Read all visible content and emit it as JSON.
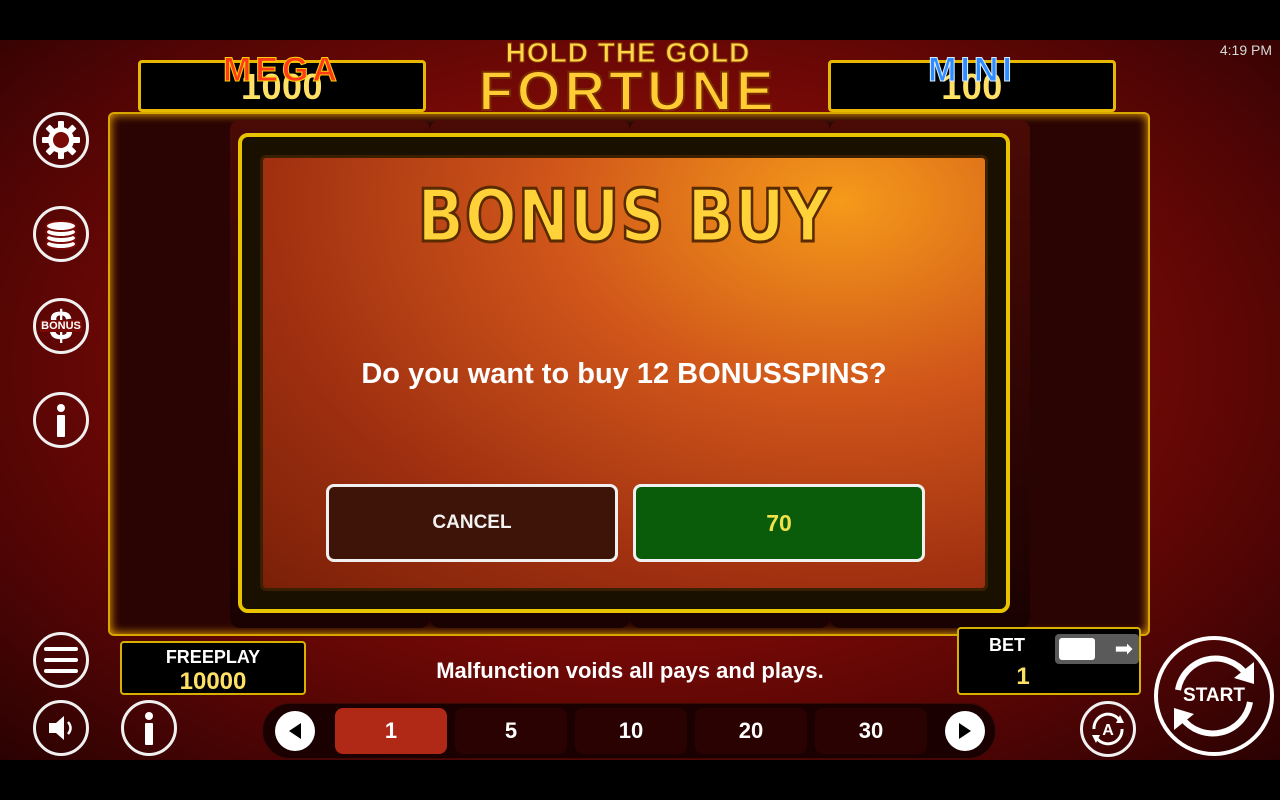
{
  "status_bar": {
    "time": "4:19 PM"
  },
  "jackpots": {
    "mega": {
      "label": "MEGA",
      "value": "1000"
    },
    "mini": {
      "label": "MINI",
      "value": "100"
    }
  },
  "logo": {
    "top": "HOLD THE GOLD",
    "main": "FORTUNE"
  },
  "side_icons": [
    "gear-icon",
    "coins-icon",
    "bonus-dollar-icon",
    "info-icon"
  ],
  "bonus_icon_text": "BONUS",
  "modal": {
    "title": "BONUS BUY",
    "question": "Do you want to buy 12 BONUSSPINS?",
    "cancel_label": "CANCEL",
    "buy_label": "70"
  },
  "freeplay": {
    "label": "FREEPLAY",
    "value": "10000"
  },
  "disclaimer": "Malfunction voids all pays and plays.",
  "bet": {
    "label": "BET",
    "value": "1"
  },
  "bet_selector": {
    "options": [
      "1",
      "5",
      "10",
      "20",
      "30"
    ],
    "selected": "1"
  },
  "start_label": "START",
  "auto_label": "A",
  "colors": {
    "gold": "#e8b800",
    "value_yellow": "#ffe066",
    "buy_green": "#0a5c0a",
    "cancel_brown": "#3e1408",
    "active_red": "#b02816"
  }
}
